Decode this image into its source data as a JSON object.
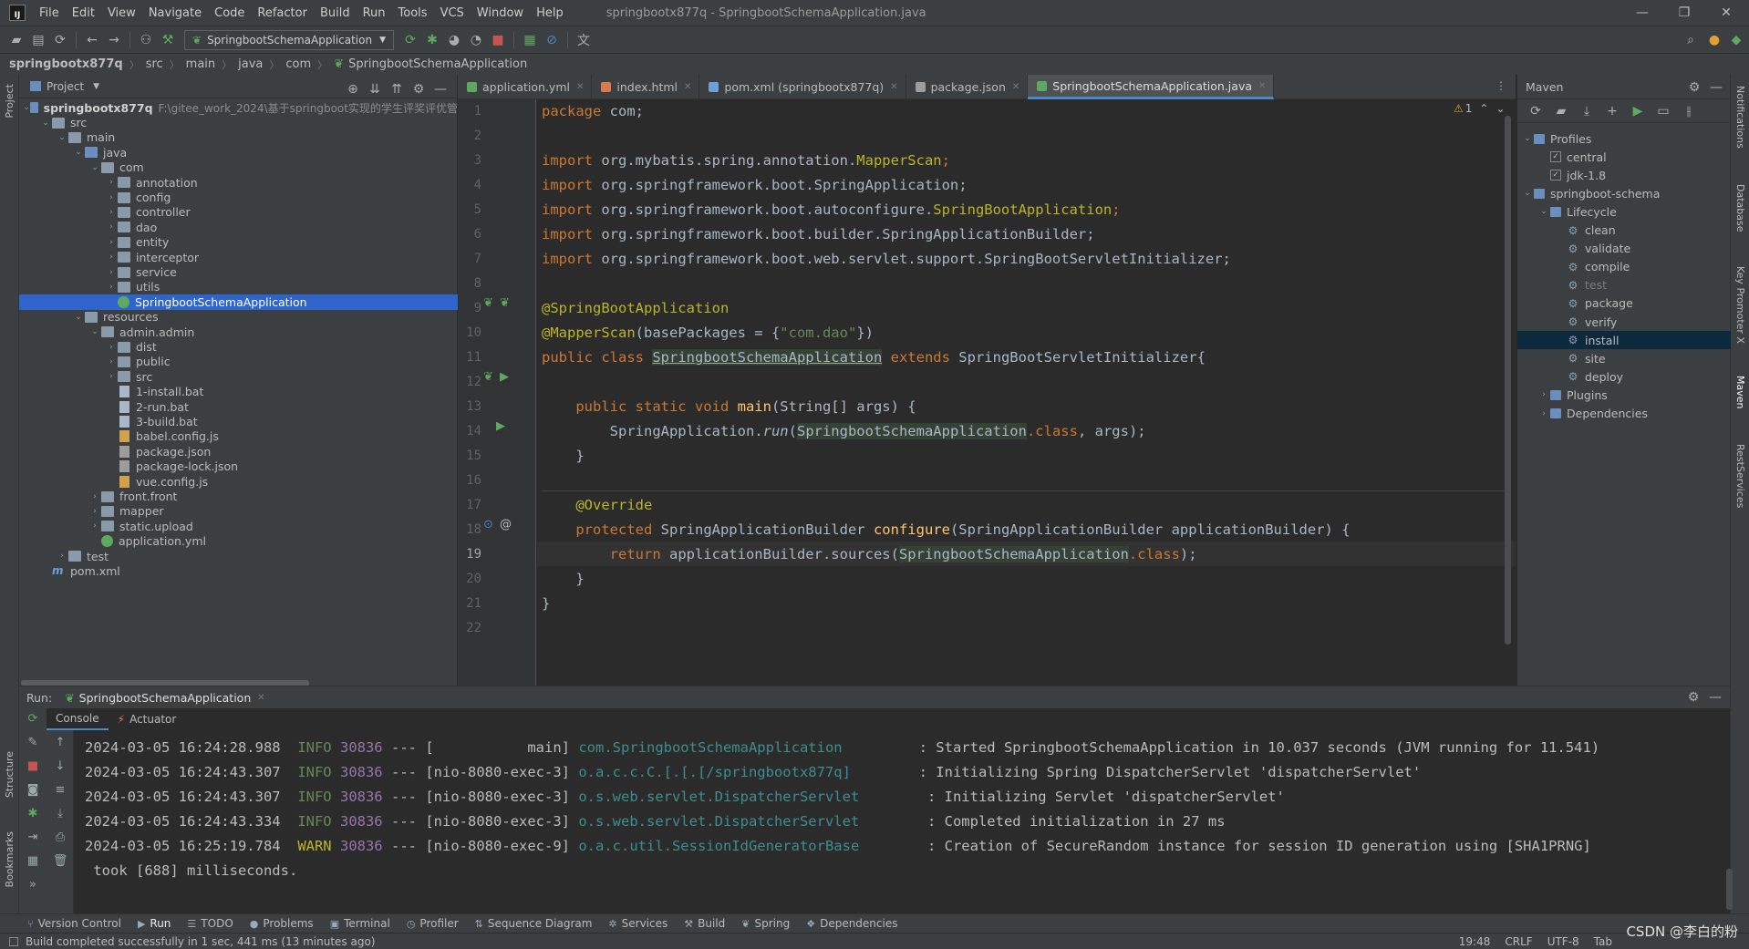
{
  "menu": {
    "logo": "IJ",
    "items": [
      "File",
      "Edit",
      "View",
      "Navigate",
      "Code",
      "Refactor",
      "Build",
      "Run",
      "Tools",
      "VCS",
      "Window",
      "Help"
    ],
    "window_title": "springbootx877q - SpringbootSchemaApplication.java"
  },
  "toolbar": {
    "run_config": "SpringbootSchemaApplication"
  },
  "breadcrumb": [
    "springbootx877q",
    "src",
    "main",
    "java",
    "com",
    "SpringbootSchemaApplication"
  ],
  "left_strip": {
    "project": "Project",
    "structure": "Structure",
    "bookmarks": "Bookmarks"
  },
  "right_strip": {
    "notifications": "Notifications",
    "database": "Database",
    "key_promoter": "Key Promoter X",
    "maven": "Maven",
    "restservices": "RestServices"
  },
  "project": {
    "title": "Project",
    "tree": [
      {
        "label": "springbootx877q",
        "path": "F:\\gitee_work_2024\\基于springboot实现的学生评奖评优管",
        "depth": 0,
        "type": "module",
        "open": true
      },
      {
        "label": "src",
        "depth": 1,
        "type": "folder",
        "open": true
      },
      {
        "label": "main",
        "depth": 2,
        "type": "folder",
        "open": true
      },
      {
        "label": "java",
        "depth": 3,
        "type": "folder-blue",
        "open": true
      },
      {
        "label": "com",
        "depth": 4,
        "type": "folder",
        "open": true
      },
      {
        "label": "annotation",
        "depth": 5,
        "type": "folder",
        "open": false
      },
      {
        "label": "config",
        "depth": 5,
        "type": "folder",
        "open": false
      },
      {
        "label": "controller",
        "depth": 5,
        "type": "folder",
        "open": false
      },
      {
        "label": "dao",
        "depth": 5,
        "type": "folder",
        "open": false
      },
      {
        "label": "entity",
        "depth": 5,
        "type": "folder",
        "open": false
      },
      {
        "label": "interceptor",
        "depth": 5,
        "type": "folder",
        "open": false
      },
      {
        "label": "service",
        "depth": 5,
        "type": "folder",
        "open": false
      },
      {
        "label": "utils",
        "depth": 5,
        "type": "folder",
        "open": false
      },
      {
        "label": "SpringbootSchemaApplication",
        "depth": 5,
        "type": "spring",
        "selected": true
      },
      {
        "label": "resources",
        "depth": 3,
        "type": "folder",
        "open": true
      },
      {
        "label": "admin.admin",
        "depth": 4,
        "type": "folder",
        "open": true
      },
      {
        "label": "dist",
        "depth": 5,
        "type": "folder",
        "open": false
      },
      {
        "label": "public",
        "depth": 5,
        "type": "folder",
        "open": false
      },
      {
        "label": "src",
        "depth": 5,
        "type": "folder",
        "open": false
      },
      {
        "label": "1-install.bat",
        "depth": 5,
        "type": "file"
      },
      {
        "label": "2-run.bat",
        "depth": 5,
        "type": "file"
      },
      {
        "label": "3-build.bat",
        "depth": 5,
        "type": "file"
      },
      {
        "label": "babel.config.js",
        "depth": 5,
        "type": "js"
      },
      {
        "label": "package.json",
        "depth": 5,
        "type": "json"
      },
      {
        "label": "package-lock.json",
        "depth": 5,
        "type": "json"
      },
      {
        "label": "vue.config.js",
        "depth": 5,
        "type": "js"
      },
      {
        "label": "front.front",
        "depth": 4,
        "type": "folder",
        "open": false
      },
      {
        "label": "mapper",
        "depth": 4,
        "type": "folder",
        "open": false
      },
      {
        "label": "static.upload",
        "depth": 4,
        "type": "folder",
        "open": false
      },
      {
        "label": "application.yml",
        "depth": 4,
        "type": "spring"
      },
      {
        "label": "test",
        "depth": 2,
        "type": "folder",
        "open": false
      },
      {
        "label": "pom.xml",
        "depth": 1,
        "type": "maven"
      }
    ]
  },
  "editor": {
    "tabs": [
      {
        "label": "application.yml",
        "color": "#5fa85f",
        "active": false
      },
      {
        "label": "index.html",
        "color": "#d87a4b",
        "active": false
      },
      {
        "label": "pom.xml (springbootx877q)",
        "color": "#6f9ed9",
        "active": false
      },
      {
        "label": "package.json",
        "color": "#9c9c9c",
        "active": false
      },
      {
        "label": "SpringbootSchemaApplication.java",
        "color": "#5fa85f",
        "active": true
      }
    ],
    "warning_count": "1",
    "current_line": 19,
    "lines": [
      {
        "n": "1"
      },
      {
        "n": "2"
      },
      {
        "n": "3"
      },
      {
        "n": "4"
      },
      {
        "n": "5"
      },
      {
        "n": "6"
      },
      {
        "n": "7"
      },
      {
        "n": "8"
      },
      {
        "n": "9"
      },
      {
        "n": "10"
      },
      {
        "n": "11"
      },
      {
        "n": "12"
      },
      {
        "n": "13"
      },
      {
        "n": "14"
      },
      {
        "n": "15"
      },
      {
        "n": "16"
      },
      {
        "n": "17"
      },
      {
        "n": "18"
      },
      {
        "n": "19"
      },
      {
        "n": "20"
      },
      {
        "n": "21"
      },
      {
        "n": "22"
      }
    ],
    "code": {
      "l1_kw": "package",
      "l1_rest": " com;",
      "l3_kw": "import",
      "l3_pkg": " org.mybatis.spring.annotation.",
      "l3_ann": "MapperScan",
      "l3_end": ";",
      "l4_kw": "import",
      "l4_rest": " org.springframework.boot.SpringApplication;",
      "l5_kw": "import",
      "l5_pkg": " org.springframework.boot.autoconfigure.",
      "l5_ann": "SpringBootApplication",
      "l5_end": ";",
      "l6_kw": "import",
      "l6_rest": " org.springframework.boot.builder.SpringApplicationBuilder;",
      "l7_kw": "import",
      "l7_rest": " org.springframework.boot.web.servlet.support.SpringBootServletInitializer;",
      "l9_ann": "@SpringBootApplication",
      "l10_ann": "@MapperScan",
      "l10_a": "(basePackages = {",
      "l10_str": "\"com.dao\"",
      "l10_b": "})",
      "l11_kw1": "public class ",
      "l11_cls": "SpringbootSchemaApplication",
      "l11_kw2": " extends ",
      "l11_rest": "SpringBootServletInitializer{",
      "l13_kw": "public static void ",
      "l13_fn": "main",
      "l13_rest": "(String[] args) {",
      "l14_a": "SpringApplication.",
      "l14_it": "run",
      "l14_b": "(",
      "l14_cls": "SpringbootSchemaApplication",
      "l14_kw": ".class",
      "l14_c": ", args);",
      "l15": "}",
      "l17_ann": "@Override",
      "l18_kw": "protected ",
      "l18_a": "SpringApplicationBuilder ",
      "l18_fn": "configure",
      "l18_b": "(SpringApplicationBuilder applicationBuilder) {",
      "l19_kw": "return ",
      "l19_a": "applicationBuilder.sources(",
      "l19_cls": "SpringbootSchemaApplication",
      "l19_kw2": ".class",
      "l19_b": ");",
      "l20": "}",
      "l21": "}"
    }
  },
  "maven": {
    "title": "Maven",
    "tree": [
      {
        "label": "Profiles",
        "depth": 0,
        "type": "folder",
        "open": true
      },
      {
        "label": "central",
        "depth": 1,
        "type": "check",
        "checked": true
      },
      {
        "label": "jdk-1.8",
        "depth": 1,
        "type": "check",
        "checked": true
      },
      {
        "label": "springboot-schema",
        "depth": 0,
        "type": "module",
        "open": true
      },
      {
        "label": "Lifecycle",
        "depth": 1,
        "type": "folder",
        "open": true
      },
      {
        "label": "clean",
        "depth": 2,
        "type": "goal"
      },
      {
        "label": "validate",
        "depth": 2,
        "type": "goal"
      },
      {
        "label": "compile",
        "depth": 2,
        "type": "goal"
      },
      {
        "label": "test",
        "depth": 2,
        "type": "goal",
        "dim": true
      },
      {
        "label": "package",
        "depth": 2,
        "type": "goal"
      },
      {
        "label": "verify",
        "depth": 2,
        "type": "goal"
      },
      {
        "label": "install",
        "depth": 2,
        "type": "goal",
        "selected": true
      },
      {
        "label": "site",
        "depth": 2,
        "type": "goal"
      },
      {
        "label": "deploy",
        "depth": 2,
        "type": "goal"
      },
      {
        "label": "Plugins",
        "depth": 1,
        "type": "folder",
        "open": false
      },
      {
        "label": "Dependencies",
        "depth": 1,
        "type": "folder",
        "open": false
      }
    ]
  },
  "run": {
    "label": "Run:",
    "config": "SpringbootSchemaApplication",
    "tabs": [
      "Console",
      "Actuator"
    ],
    "logs": [
      {
        "ts": "2024-03-05 16:24:28.988",
        "level": "INFO",
        "pid": "30836",
        "dash": "---",
        "thread": "[           main]",
        "cls": "com.SpringbootSchemaApplication        ",
        "msg": ": Started SpringbootSchemaApplication in 10.037 seconds (JVM running for 11.541)"
      },
      {
        "ts": "2024-03-05 16:24:43.307",
        "level": "INFO",
        "pid": "30836",
        "dash": "---",
        "thread": "[nio-8080-exec-3]",
        "cls": "o.a.c.c.C.[.[.[/springbootx877q]       ",
        "msg": ": Initializing Spring DispatcherServlet 'dispatcherServlet'"
      },
      {
        "ts": "2024-03-05 16:24:43.307",
        "level": "INFO",
        "pid": "30836",
        "dash": "---",
        "thread": "[nio-8080-exec-3]",
        "cls": "o.s.web.servlet.DispatcherServlet       ",
        "msg": ": Initializing Servlet 'dispatcherServlet'"
      },
      {
        "ts": "2024-03-05 16:24:43.334",
        "level": "INFO",
        "pid": "30836",
        "dash": "---",
        "thread": "[nio-8080-exec-3]",
        "cls": "o.s.web.servlet.DispatcherServlet       ",
        "msg": ": Completed initialization in 27 ms"
      },
      {
        "ts": "2024-03-05 16:25:19.784",
        "level": "WARN",
        "pid": "30836",
        "dash": "---",
        "thread": "[nio-8080-exec-9]",
        "cls": "o.a.c.util.SessionIdGeneratorBase       ",
        "msg": ": Creation of SecureRandom instance for session ID generation using [SHA1PRNG]"
      }
    ],
    "continuation": " took [688] milliseconds."
  },
  "bottom_tabs": [
    {
      "label": "Version Control",
      "icon": "⑂"
    },
    {
      "label": "Run",
      "icon": "▶",
      "active": true
    },
    {
      "label": "TODO",
      "icon": "☰"
    },
    {
      "label": "Problems",
      "icon": "●"
    },
    {
      "label": "Terminal",
      "icon": "▣"
    },
    {
      "label": "Profiler",
      "icon": "◷"
    },
    {
      "label": "Sequence Diagram",
      "icon": "⇅"
    },
    {
      "label": "Services",
      "icon": "✲"
    },
    {
      "label": "Build",
      "icon": "⚒"
    },
    {
      "label": "Spring",
      "icon": "❦"
    },
    {
      "label": "Dependencies",
      "icon": "❖"
    }
  ],
  "status": {
    "message": "Build completed successfully in 1 sec, 441 ms (13 minutes ago)",
    "position": "19:48",
    "line_sep": "CRLF",
    "encoding": "UTF-8",
    "indent": "Tab"
  },
  "watermark": "CSDN @李白的粉"
}
